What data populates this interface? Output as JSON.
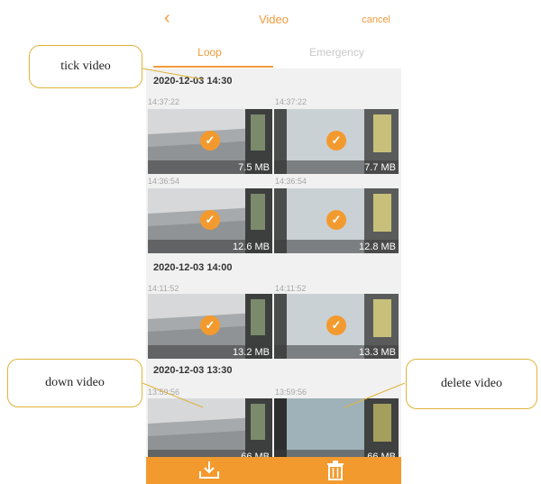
{
  "header": {
    "back_glyph": "‹",
    "title": "Video",
    "cancel": "cancel"
  },
  "tabs": [
    {
      "label": "Loop",
      "active": true
    },
    {
      "label": "Emergency",
      "active": false
    }
  ],
  "groups": [
    {
      "title": "2020-12-03 14:30",
      "clips": [
        {
          "time": "14:37:22",
          "size": "7.5 MB",
          "checked": true
        },
        {
          "time": "14:37:22",
          "size": "7.7 MB",
          "checked": true
        },
        {
          "time": "14:36:54",
          "size": "12.6 MB",
          "checked": true
        },
        {
          "time": "14:36:54",
          "size": "12.8 MB",
          "checked": true
        }
      ]
    },
    {
      "title": "2020-12-03 14:00",
      "clips": [
        {
          "time": "14:11:52",
          "size": "13.2 MB",
          "checked": true
        },
        {
          "time": "14:11:52",
          "size": "13.3 MB",
          "checked": true
        }
      ]
    },
    {
      "title": "2020-12-03 13:30",
      "clips": [
        {
          "time": "13:59:56",
          "size": "66 MB",
          "checked": false
        },
        {
          "time": "13:59:56",
          "size": "66 MB",
          "checked": false
        }
      ]
    }
  ],
  "check_glyph": "✓",
  "bottom_bar": {
    "download_icon": "download-icon",
    "delete_icon": "trash-icon"
  },
  "callouts": {
    "tick": "tick video",
    "down": "down video",
    "delete": "delete video"
  },
  "colors": {
    "accent": "#f39a2f",
    "callout_border": "#e0b33a"
  }
}
